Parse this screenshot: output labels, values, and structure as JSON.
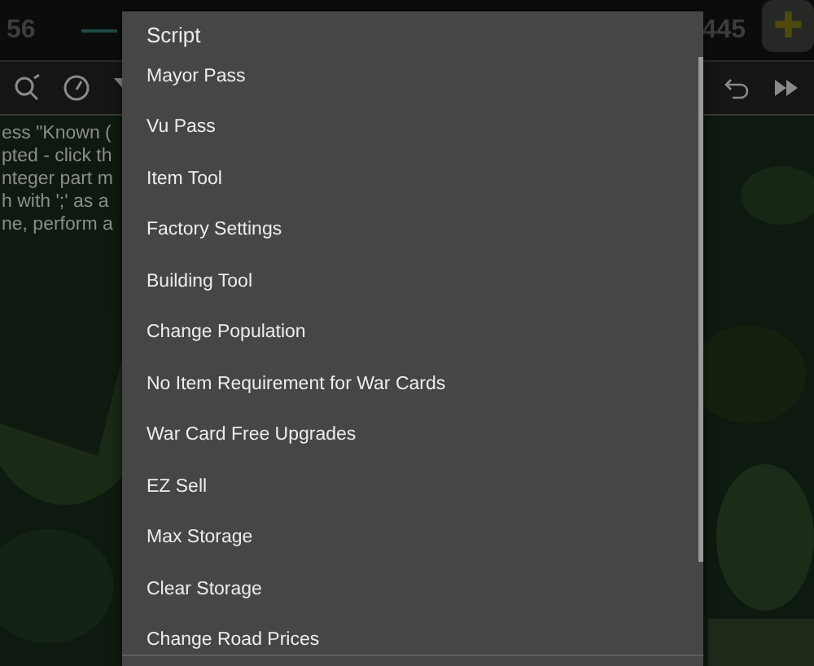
{
  "top_bar": {
    "left_count": "56",
    "right_count": "445",
    "add_button": "✚"
  },
  "background_text": [
    "ess \"Known (",
    "pted - click th",
    "nteger part m",
    "h with ';' as a",
    "ne, perform a"
  ],
  "menu": {
    "title": "Script",
    "items": [
      "Mayor Pass",
      "Vu Pass",
      "Item Tool",
      "Factory Settings",
      "Building Tool",
      "Change Population",
      "No Item Requirement for War Cards",
      "War Card Free Upgrades",
      "EZ Sell",
      "Max Storage",
      "Clear Storage",
      "Change Road Prices"
    ]
  }
}
